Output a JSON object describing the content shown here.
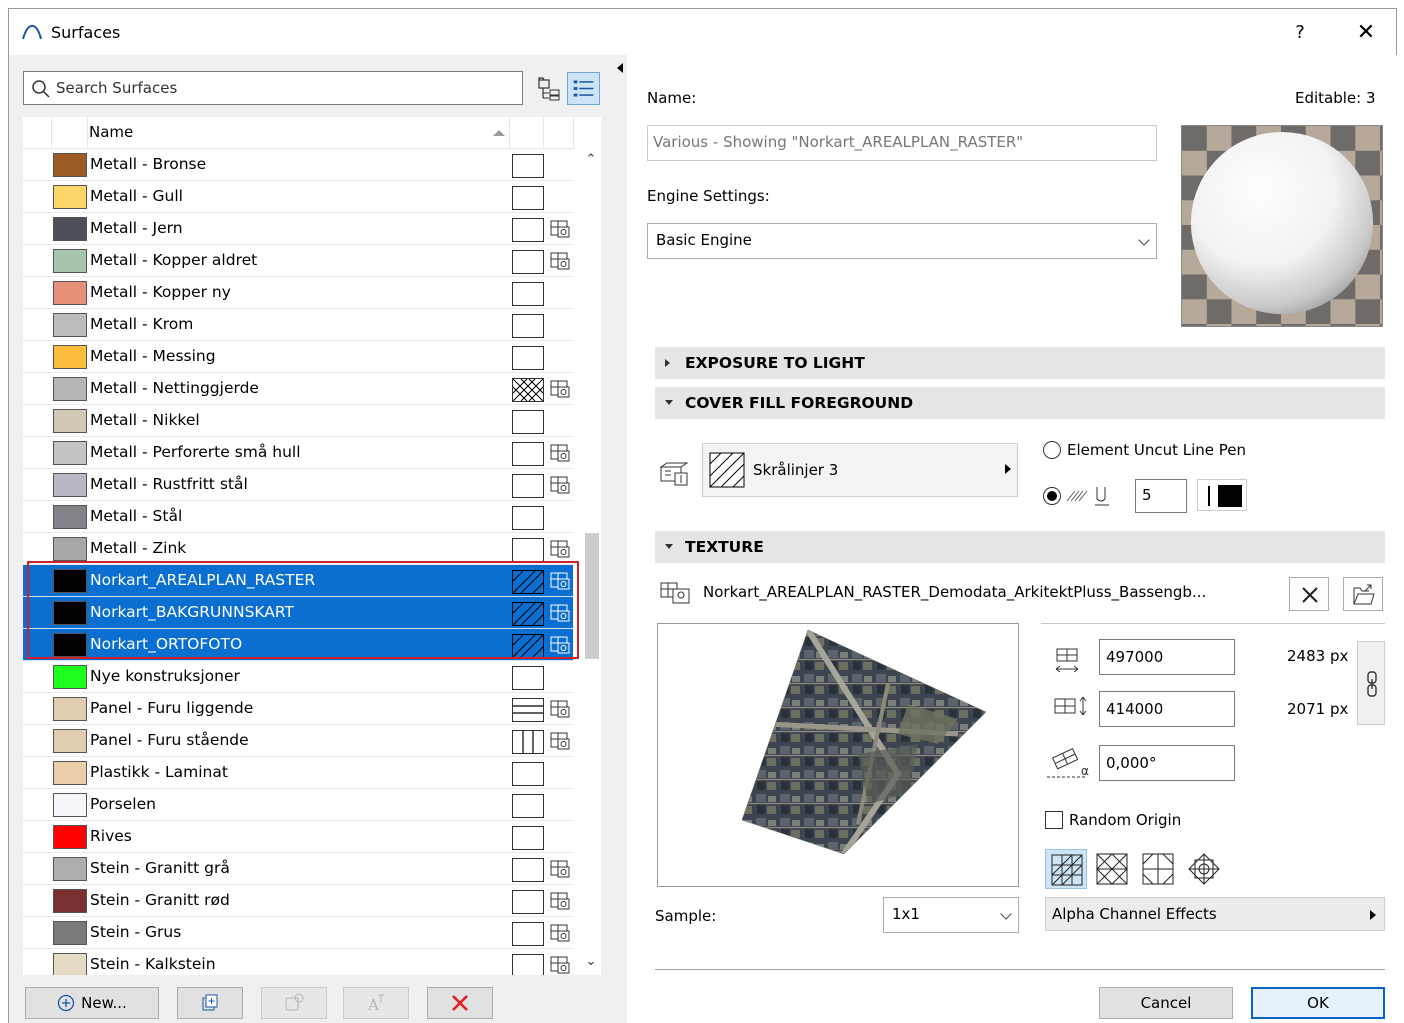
{
  "window": {
    "title": "Surfaces",
    "help": "?",
    "close": "✕"
  },
  "left": {
    "search_placeholder": "Search Surfaces",
    "list_header": "Name",
    "rows": [
      {
        "name": "Metall - Bronse",
        "color": "#9c5a24",
        "fill": "empty",
        "texture": false,
        "selected": false
      },
      {
        "name": "Metall - Gull",
        "color": "#fdd66a",
        "fill": "empty",
        "texture": false,
        "selected": false
      },
      {
        "name": "Metall - Jern",
        "color": "#4d5056",
        "fill": "empty",
        "texture": true,
        "selected": false
      },
      {
        "name": "Metall - Kopper aldret",
        "color": "#a8c6ae",
        "fill": "empty",
        "texture": true,
        "selected": false
      },
      {
        "name": "Metall - Kopper ny",
        "color": "#e6907a",
        "fill": "empty",
        "texture": false,
        "selected": false
      },
      {
        "name": "Metall - Krom",
        "color": "#bcbcbc",
        "fill": "empty",
        "texture": false,
        "selected": false
      },
      {
        "name": "Metall - Messing",
        "color": "#fbbc3c",
        "fill": "empty",
        "texture": false,
        "selected": false
      },
      {
        "name": "Metall - Nettinggjerde",
        "color": "#b6b6b6",
        "fill": "cross",
        "texture": true,
        "selected": false
      },
      {
        "name": "Metall - Nikkel",
        "color": "#d2c8b6",
        "fill": "empty",
        "texture": false,
        "selected": false
      },
      {
        "name": "Metall - Perforerte små hull",
        "color": "#c4c4c4",
        "fill": "empty",
        "texture": true,
        "selected": false
      },
      {
        "name": "Metall - Rustfritt stål",
        "color": "#b8b8c6",
        "fill": "empty",
        "texture": true,
        "selected": false
      },
      {
        "name": "Metall - Stål",
        "color": "#838389",
        "fill": "empty",
        "texture": false,
        "selected": false
      },
      {
        "name": "Metall - Zink",
        "color": "#a8a8a8",
        "fill": "empty",
        "texture": true,
        "selected": false
      },
      {
        "name": "Norkart_AREALPLAN_RASTER",
        "color": "#000000",
        "fill": "hatch",
        "texture": true,
        "selected": true
      },
      {
        "name": "Norkart_BAKGRUNNSKART",
        "color": "#000000",
        "fill": "hatch",
        "texture": true,
        "selected": true
      },
      {
        "name": "Norkart_ORTOFOTO",
        "color": "#000000",
        "fill": "hatch",
        "texture": true,
        "selected": true
      },
      {
        "name": "Nye konstruksjoner",
        "color": "#1eff1e",
        "fill": "empty",
        "texture": false,
        "selected": false
      },
      {
        "name": "Panel - Furu liggende",
        "color": "#e0cdb2",
        "fill": "horiz",
        "texture": true,
        "selected": false
      },
      {
        "name": "Panel - Furu stående",
        "color": "#e0cdb2",
        "fill": "vert",
        "texture": true,
        "selected": false
      },
      {
        "name": "Plastikk - Laminat",
        "color": "#eccdaa",
        "fill": "empty",
        "texture": false,
        "selected": false
      },
      {
        "name": "Porselen",
        "color": "#f8f8fc",
        "fill": "empty",
        "texture": false,
        "selected": false
      },
      {
        "name": "Rives",
        "color": "#ff0000",
        "fill": "empty",
        "texture": false,
        "selected": false
      },
      {
        "name": "Stein - Granitt grå",
        "color": "#aeaeae",
        "fill": "empty",
        "texture": true,
        "selected": false
      },
      {
        "name": "Stein - Granitt rød",
        "color": "#7a2f30",
        "fill": "empty",
        "texture": true,
        "selected": false
      },
      {
        "name": "Stein - Grus",
        "color": "#7a7a7a",
        "fill": "empty",
        "texture": true,
        "selected": false
      },
      {
        "name": "Stein - Kalkstein",
        "color": "#e6dcc6",
        "fill": "empty",
        "texture": true,
        "selected": false
      }
    ],
    "buttons": {
      "new": "New..."
    }
  },
  "right": {
    "name_label": "Name:",
    "editable": "Editable: 3",
    "name_value": "Various - Showing \"Norkart_AREALPLAN_RASTER\"",
    "engine_label": "Engine Settings:",
    "engine_value": "Basic Engine",
    "sections": {
      "exposure": "EXPOSURE TO LIGHT",
      "cover_fill": "COVER FILL FOREGROUND",
      "texture": "TEXTURE"
    },
    "fill_name": "Skrålinjer 3",
    "uncut_pen": "Element Uncut Line Pen",
    "pen_value": "5",
    "texture_file": "Norkart_AREALPLAN_RASTER_Demodata_ArkitektPluss_Bassengb...",
    "width_value": "497000",
    "width_px": "2483 px",
    "height_value": "414000",
    "height_px": "2071 px",
    "angle_value": "0,000°",
    "random_origin": "Random Origin",
    "sample_label": "Sample:",
    "sample_value": "1x1",
    "alpha_effects": "Alpha Channel Effects",
    "cancel": "Cancel",
    "ok": "OK"
  }
}
